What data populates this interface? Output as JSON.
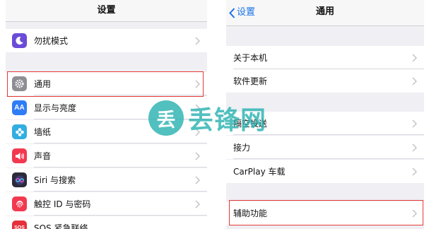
{
  "left": {
    "title": "设置",
    "items": [
      {
        "label": "勿扰模式",
        "icon": "moon-icon",
        "color": "#6a4cd8"
      },
      {
        "label": "通用",
        "icon": "gear-icon",
        "color": "#8e8e93"
      },
      {
        "label": "显示与亮度",
        "icon": "text-size-icon",
        "color": "#2f7df6"
      },
      {
        "label": "墙纸",
        "icon": "flower-icon",
        "color": "#32aee0"
      },
      {
        "label": "声音",
        "icon": "speaker-icon",
        "color": "#f2394f"
      },
      {
        "label": "Siri 与搜索",
        "icon": "siri-icon",
        "color": "#2b2b3a"
      },
      {
        "label": "触控 ID 与密码",
        "icon": "fingerprint-icon",
        "color": "#f2394f"
      },
      {
        "label": "SOS 紧急联络",
        "icon": "sos-icon",
        "color": "#e5303a"
      }
    ]
  },
  "right": {
    "back_label": "设置",
    "title": "通用",
    "group1": [
      "关于本机",
      "软件更新"
    ],
    "group2": [
      "隔空投送",
      "接力",
      "CarPlay 车载"
    ],
    "group3": [
      "辅助功能"
    ]
  },
  "watermark": {
    "badge": "丢",
    "text": "丢锋网"
  },
  "colors": {
    "highlight": "#e53935",
    "accent": "#1a73e8",
    "watermark": "#2bb3b1"
  }
}
